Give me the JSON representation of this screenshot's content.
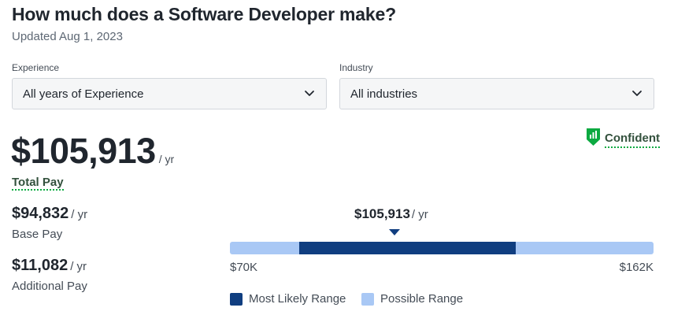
{
  "header": {
    "title": "How much does a Software Developer make?",
    "updated": "Updated Aug 1, 2023"
  },
  "filters": {
    "experience": {
      "label": "Experience",
      "value": "All years of Experience"
    },
    "industry": {
      "label": "Industry",
      "value": "All industries"
    }
  },
  "confidence": {
    "label": "Confident",
    "icon": "shield-bars-icon",
    "color": "#0caa41"
  },
  "total_pay": {
    "amount": "$105,913",
    "unit": "/ yr",
    "label": "Total Pay"
  },
  "base_pay": {
    "amount": "$94,832",
    "unit": "/ yr",
    "label": "Base Pay"
  },
  "additional_pay": {
    "amount": "$11,082",
    "unit": "/ yr",
    "label": "Additional Pay"
  },
  "range": {
    "marker_amount": "$105,913",
    "marker_unit": "/ yr",
    "min_label": "$70K",
    "max_label": "$162K",
    "min": 70000,
    "max": 162000,
    "likely_low": 85000,
    "likely_high": 132000,
    "median": 105913,
    "likely_color": "#103e80",
    "possible_color": "#a9c8f5"
  },
  "legend": {
    "most_likely": "Most Likely Range",
    "possible": "Possible Range"
  }
}
